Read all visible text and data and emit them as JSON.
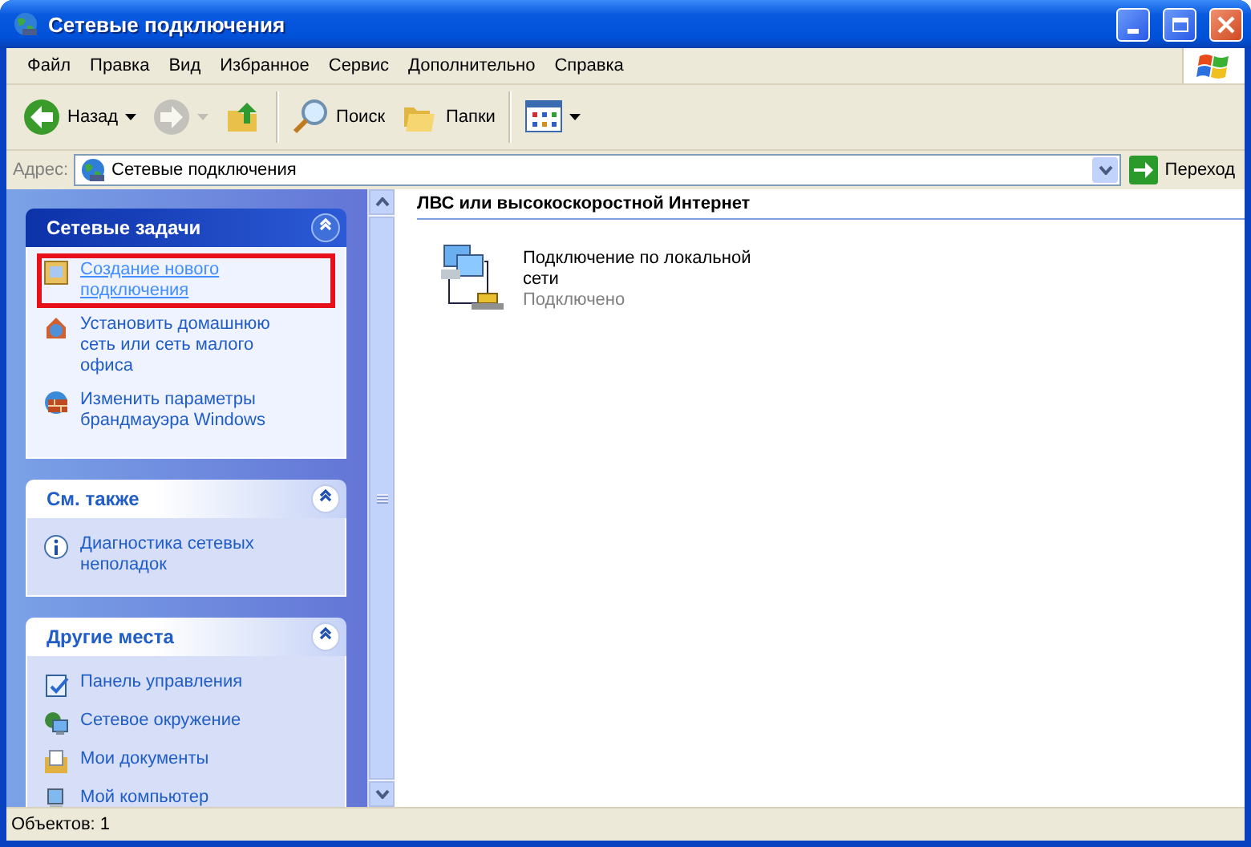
{
  "window": {
    "title": "Сетевые подключения"
  },
  "menu": [
    "Файл",
    "Правка",
    "Вид",
    "Избранное",
    "Сервис",
    "Дополнительно",
    "Справка"
  ],
  "toolbar": [
    {
      "kind": "back",
      "label": "Назад",
      "dropdown": true,
      "disabled": false
    },
    {
      "kind": "forward",
      "dropdown": true,
      "disabled": true
    },
    {
      "kind": "up",
      "dropdown": false,
      "disabled": false
    },
    {
      "kind": "search",
      "label": "Поиск",
      "dropdown": false,
      "disabled": false
    },
    {
      "kind": "folders",
      "label": "Папки",
      "dropdown": false,
      "disabled": false
    },
    {
      "kind": "views",
      "dropdown": true,
      "disabled": false
    }
  ],
  "address": {
    "label": "Адрес:",
    "value": "Сетевые подключения",
    "go": "Переход"
  },
  "sidebar": [
    {
      "title": "Сетевые задачи",
      "kind": "primary",
      "expanded": true,
      "items": [
        {
          "text": "Создание нового подключения",
          "highlighted": true,
          "hover": true
        },
        {
          "text": "Установить домашнюю сеть или сеть малого офиса",
          "highlighted": false,
          "hover": false
        },
        {
          "text": "Изменить параметры брандмауэра Windows",
          "highlighted": false,
          "hover": false
        }
      ]
    },
    {
      "title": "См. также",
      "kind": "normal",
      "expanded": true,
      "items": [
        {
          "text": "Диагностика сетевых неполадок",
          "highlighted": false,
          "hover": false
        }
      ]
    },
    {
      "title": "Другие места",
      "kind": "normal",
      "expanded": true,
      "items": [
        {
          "text": "Панель управления",
          "highlighted": false,
          "hover": false
        },
        {
          "text": "Сетевое окружение",
          "highlighted": false,
          "hover": false
        },
        {
          "text": "Мои документы",
          "highlighted": false,
          "hover": false
        },
        {
          "text": "Мой компьютер",
          "highlighted": false,
          "hover": false
        }
      ]
    }
  ],
  "content": {
    "group": "ЛВС или высокоскоростной Интернет",
    "items": [
      {
        "name": "Подключение по локальной сети",
        "status": "Подключено"
      }
    ]
  },
  "status_bar": "Объектов: 1"
}
